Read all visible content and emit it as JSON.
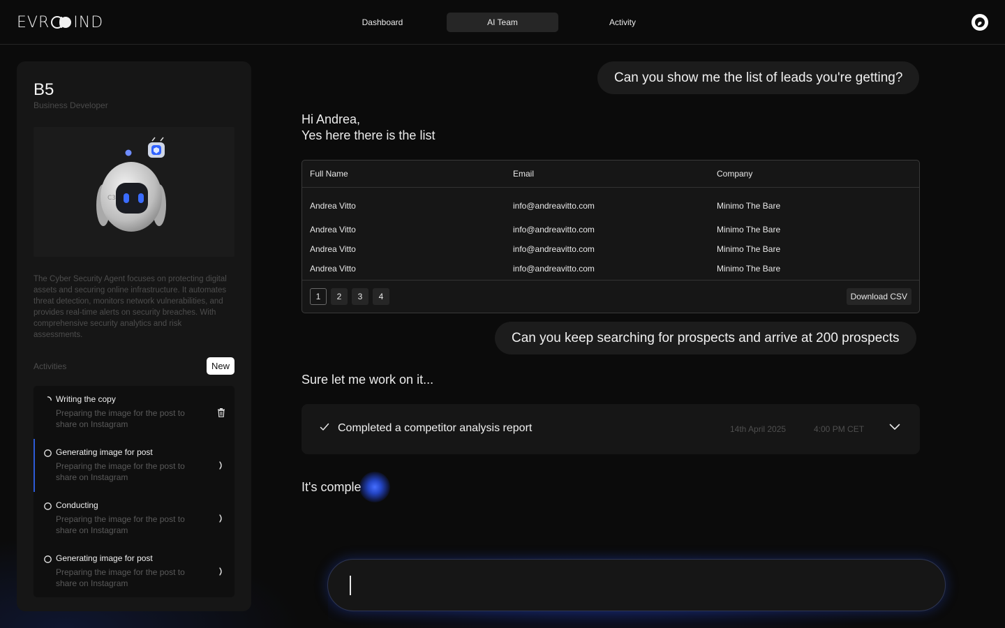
{
  "header": {
    "logo_text_left": "EVR",
    "logo_text_right": "IND",
    "nav": [
      {
        "label": "Dashboard",
        "active": false
      },
      {
        "label": "AI Team",
        "active": true
      },
      {
        "label": "Activity",
        "active": false
      }
    ]
  },
  "agent": {
    "name": "B5",
    "role": "Business Developer",
    "description": "The Cyber Security Agent focuses on protecting digital assets and securing online infrastructure. It automates threat detection, monitors network vulnerabilities, and provides real-time alerts on security breaches. With comprehensive security analytics and risk assessments.",
    "activities_label": "Activities",
    "new_label": "New",
    "activities": [
      {
        "title": "Writing the copy",
        "subtitle": "Preparing the image for the post to share on Instagram",
        "status": "in-progress",
        "action_icon": "trash-icon"
      },
      {
        "title": "Generating image for post",
        "subtitle": "Preparing the image for the post to share on Instagram",
        "status": "pending",
        "action_icon": "chevron-right-icon",
        "selected": true
      },
      {
        "title": "Conducting",
        "subtitle": "Preparing the image for the post to share on Instagram",
        "status": "pending",
        "action_icon": "chevron-right-icon"
      },
      {
        "title": "Generating image for post",
        "subtitle": "Preparing the image for the post to share on Instagram",
        "status": "pending",
        "action_icon": "chevron-right-icon"
      }
    ]
  },
  "chat": {
    "user_message_1": "Can you show me the list of  leads you're getting?",
    "reply_1_line1": "Hi Andrea,",
    "reply_1_line2": "Yes here there is the list",
    "table": {
      "columns": [
        "Full Name",
        "Email",
        "Company"
      ],
      "rows": [
        [
          "Andrea Vitto",
          "info@andreavitto.com",
          "Minimo The Bare"
        ],
        [
          "Andrea Vitto",
          "info@andreavitto.com",
          "Minimo The Bare"
        ],
        [
          "Andrea Vitto",
          "info@andreavitto.com",
          "Minimo The Bare"
        ],
        [
          "Andrea Vitto",
          "info@andreavitto.com",
          "Minimo The Bare"
        ]
      ],
      "pages": [
        "1",
        "2",
        "3",
        "4"
      ],
      "current_page": "1",
      "download_label": "Download CSV"
    },
    "user_message_2": "Can you keep searching for prospects and arrive at 200 prospects",
    "reply_2": "Sure let me work on it...",
    "task": {
      "title": "Completed a competitor analysis report",
      "date": "14th April 2025",
      "time": "4:00 PM CET"
    },
    "typing_text": "It's comple",
    "input_value": ""
  },
  "colors": {
    "accent_blue": "#2d5bd8",
    "background": "#0b0b0b",
    "card": "#161616"
  }
}
